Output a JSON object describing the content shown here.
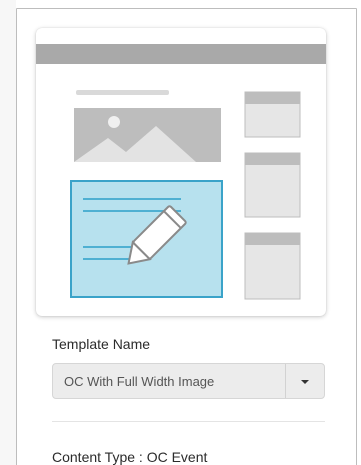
{
  "template": {
    "label": "Template Name",
    "selected_value": "OC With Full Width Image"
  },
  "content_type": {
    "text": "Content Type : OC Event"
  },
  "icons": {
    "preview_image": "image-placeholder-icon",
    "edit": "pencil-icon",
    "dropdown": "chevron-down-icon"
  },
  "colors": {
    "selected_block_fill": "#b7e1ee",
    "selected_block_border": "#3aa3c9",
    "preview_header": "#a9a9a9",
    "placeholder_gray": "#bdbdbd"
  }
}
